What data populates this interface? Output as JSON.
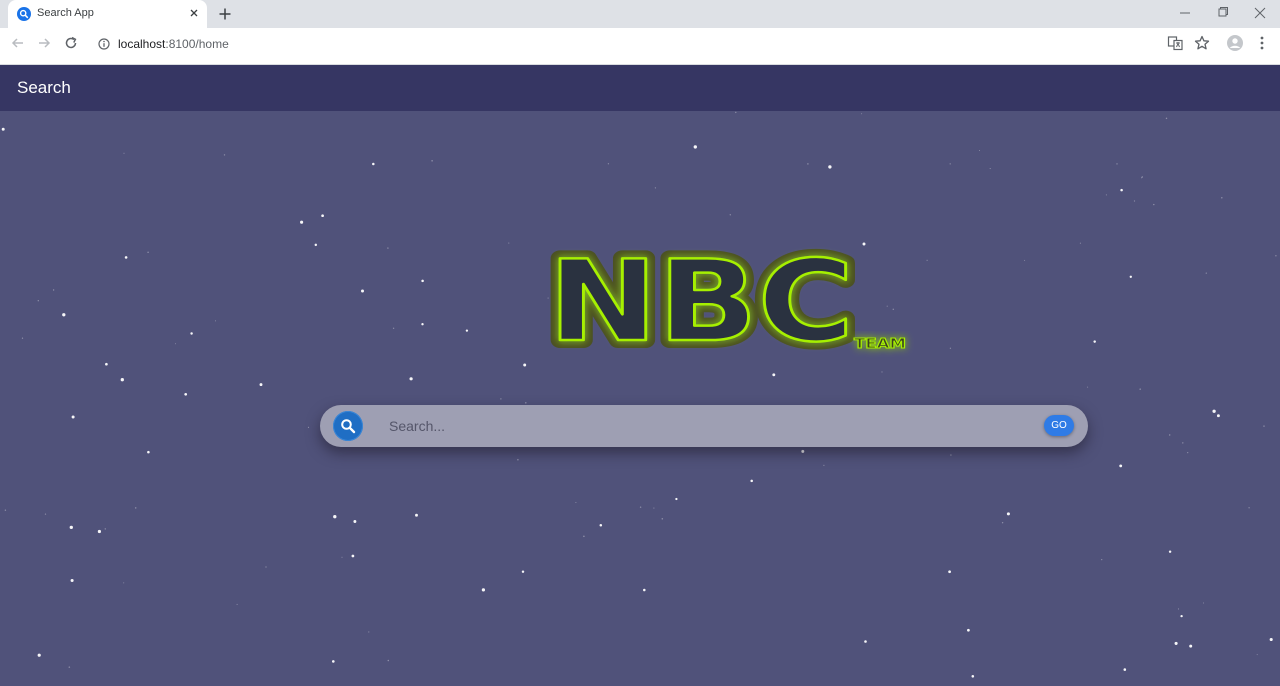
{
  "browser": {
    "tab_title": "Search App",
    "url_host": "localhost",
    "url_rest": ":8100/home"
  },
  "app": {
    "header_title": "Search"
  },
  "logo": {
    "main_text": "NBC",
    "sub_text": "TEAM",
    "glow_color": "#a6f000"
  },
  "search": {
    "placeholder": "Search...",
    "go_label": "GO",
    "accent_color": "#2f7be6"
  },
  "colors": {
    "background": "#50527a",
    "header": "#363663"
  },
  "icons": [
    "search-icon",
    "close-icon",
    "plus-icon",
    "minimize-icon",
    "maximize-icon",
    "back-icon",
    "forward-icon",
    "reload-icon",
    "info-icon",
    "translate-icon",
    "star-icon",
    "profile-icon",
    "menu-icon"
  ]
}
